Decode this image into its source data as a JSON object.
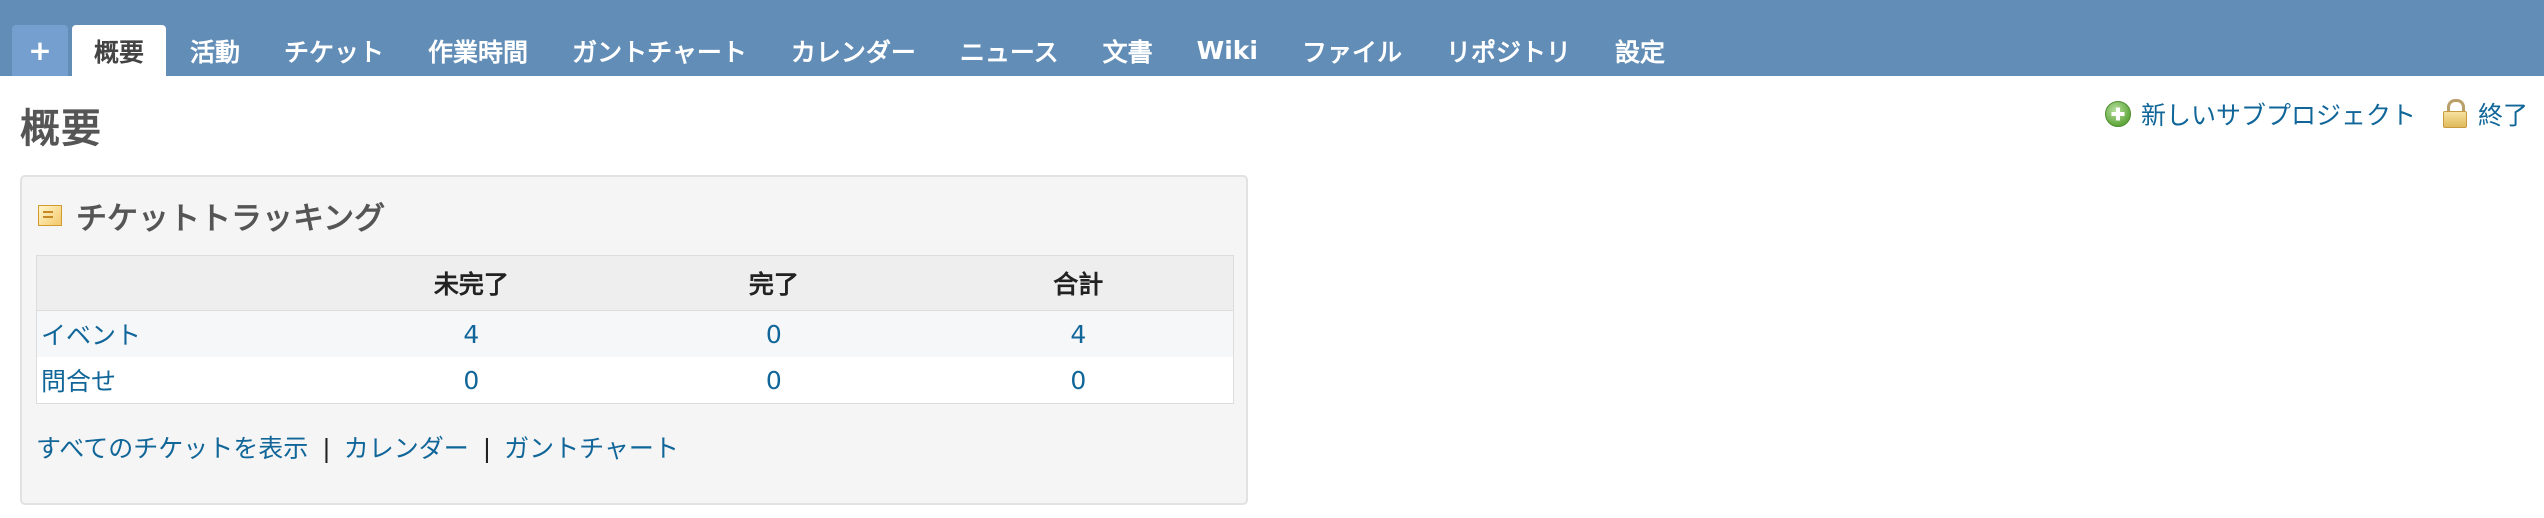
{
  "tabs": {
    "new_label": "+",
    "items": [
      {
        "label": "概要",
        "selected": true
      },
      {
        "label": "活動"
      },
      {
        "label": "チケット"
      },
      {
        "label": "作業時間"
      },
      {
        "label": "ガントチャート"
      },
      {
        "label": "カレンダー"
      },
      {
        "label": "ニュース"
      },
      {
        "label": "文書"
      },
      {
        "label": "Wiki"
      },
      {
        "label": "ファイル"
      },
      {
        "label": "リポジトリ"
      },
      {
        "label": "設定"
      }
    ]
  },
  "page": {
    "title": "概要"
  },
  "contextual": {
    "new_subproject_label": "新しいサブプロジェクト",
    "close_label": "終了",
    "icons": [
      "add-icon",
      "lock-icon"
    ]
  },
  "issue_tracking": {
    "title": "チケットトラッキング",
    "icon": "ticket-icon",
    "columns": [
      "",
      "未完了",
      "完了",
      "合計"
    ],
    "rows": [
      {
        "tracker": "イベント",
        "open": "4",
        "closed": "0",
        "total": "4"
      },
      {
        "tracker": "問合せ",
        "open": "0",
        "closed": "0",
        "total": "0"
      }
    ],
    "links": {
      "view_all_issues": "すべてのチケットを表示",
      "calendar": "カレンダー",
      "gantt": "ガントチャート",
      "separator": "|"
    }
  },
  "colors": {
    "header_bg": "#628db6",
    "link": "#116699",
    "box_bg": "#f5f5f5"
  }
}
